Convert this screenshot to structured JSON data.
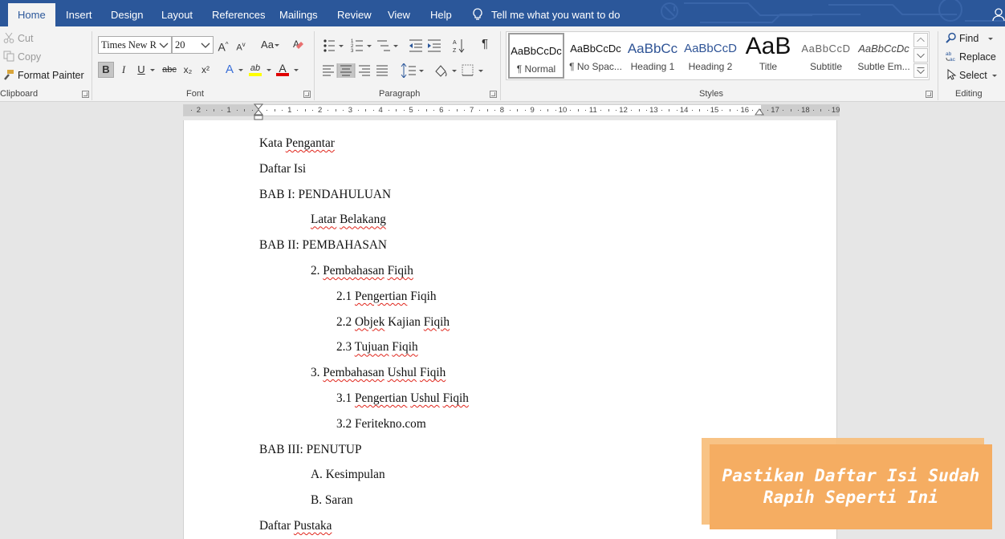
{
  "tabs": [
    "Home",
    "Insert",
    "Design",
    "Layout",
    "References",
    "Mailings",
    "Review",
    "View",
    "Help"
  ],
  "active_tab": "Home",
  "tell_me": "Tell me what you want to do",
  "clipboard": {
    "cut": "Cut",
    "copy": "Copy",
    "format_painter": "Format Painter",
    "label": "Clipboard"
  },
  "font": {
    "name": "Times New R",
    "size": "20",
    "grow": "A",
    "shrink": "A",
    "change_case": "Aa",
    "bold": "B",
    "italic": "I",
    "underline": "U",
    "strike": "abc",
    "subscript": "x₂",
    "superscript": "x²",
    "highlight": "ab",
    "font_color_label": "A",
    "text_effects": "A",
    "label": "Font",
    "highlight_color": "#ffff00",
    "font_color": "#e00000"
  },
  "paragraph": {
    "label": "Paragraph",
    "pilcrow": "¶"
  },
  "styles": {
    "label": "Styles",
    "items": [
      {
        "preview": "AaBbCcDc",
        "name": "¶ Normal"
      },
      {
        "preview": "AaBbCcDc",
        "name": "¶ No Spac..."
      },
      {
        "preview": "AaBbCc",
        "name": "Heading 1"
      },
      {
        "preview": "AaBbCcD",
        "name": "Heading 2"
      },
      {
        "preview": "AaB",
        "name": "Title"
      },
      {
        "preview": "AaBbCcD",
        "name": "Subtitle"
      },
      {
        "preview": "AaBbCcDc",
        "name": "Subtle Em..."
      }
    ]
  },
  "editing": {
    "find": "Find",
    "replace": "Replace",
    "select": "Select",
    "label": "Editing"
  },
  "ruler": {
    "left_numbers": [
      "2",
      "1"
    ],
    "right_numbers": [
      "1",
      "2",
      "3",
      "4",
      "5",
      "6",
      "7",
      "8",
      "9",
      "10",
      "11",
      "12",
      "13",
      "14",
      "15",
      "16",
      "17",
      "18",
      "19"
    ]
  },
  "document": {
    "lines": [
      {
        "indent": 0,
        "parts": [
          {
            "t": "Kata "
          },
          {
            "t": "Pengantar",
            "err": true
          }
        ]
      },
      {
        "indent": 0,
        "parts": [
          {
            "t": "Daftar Isi"
          }
        ]
      },
      {
        "indent": 0,
        "parts": [
          {
            "t": "BAB I: PENDAHULUAN"
          }
        ]
      },
      {
        "indent": 1,
        "parts": [
          {
            "t": "Latar",
            "err": true
          },
          {
            "t": " "
          },
          {
            "t": "Belakang",
            "err": true
          }
        ]
      },
      {
        "indent": 0,
        "parts": [
          {
            "t": "BAB II: PEMBAHASAN"
          }
        ]
      },
      {
        "indent": 1,
        "parts": [
          {
            "t": "2. "
          },
          {
            "t": "Pembahasan",
            "err": true
          },
          {
            "t": " "
          },
          {
            "t": "Fiqih",
            "err": true
          }
        ]
      },
      {
        "indent": 2,
        "parts": [
          {
            "t": "2.1 "
          },
          {
            "t": "Pengertian",
            "err": true
          },
          {
            "t": " Fiqih"
          }
        ]
      },
      {
        "indent": 2,
        "parts": [
          {
            "t": "2.2 "
          },
          {
            "t": "Objek",
            "err": true
          },
          {
            "t": " Kajian "
          },
          {
            "t": "Fiqih",
            "err": true
          }
        ]
      },
      {
        "indent": 2,
        "parts": [
          {
            "t": "2.3 "
          },
          {
            "t": "Tujuan",
            "err": true
          },
          {
            "t": " "
          },
          {
            "t": "Fiqih",
            "err": true
          }
        ]
      },
      {
        "indent": 1,
        "parts": [
          {
            "t": "3. "
          },
          {
            "t": "Pembahasan",
            "err": true
          },
          {
            "t": " "
          },
          {
            "t": "Ushul",
            "err": true
          },
          {
            "t": " "
          },
          {
            "t": "Fiqih",
            "err": true
          }
        ]
      },
      {
        "indent": 2,
        "parts": [
          {
            "t": "3.1 "
          },
          {
            "t": "Pengertian",
            "err": true
          },
          {
            "t": " "
          },
          {
            "t": "Ushul",
            "err": true
          },
          {
            "t": " "
          },
          {
            "t": "Fiqih",
            "err": true
          }
        ]
      },
      {
        "indent": 2,
        "parts": [
          {
            "t": "3.2 Feritekno.com"
          }
        ]
      },
      {
        "indent": 0,
        "parts": [
          {
            "t": "BAB III: PENUTUP"
          }
        ]
      },
      {
        "indent": 1,
        "parts": [
          {
            "t": "A. Kesimpulan"
          }
        ]
      },
      {
        "indent": 1,
        "parts": [
          {
            "t": "B. Saran"
          }
        ]
      },
      {
        "indent": 0,
        "parts": [
          {
            "t": "Daftar "
          },
          {
            "t": "Pustaka",
            "err": true
          }
        ]
      }
    ]
  },
  "banner": {
    "line1": "Pastikan Daftar Isi Sudah",
    "line2": "Rapih Seperti Ini"
  },
  "colors": {
    "ribbon_blue": "#2b579a",
    "spell_error": "#e0251b",
    "banner": "#f5ad62"
  }
}
